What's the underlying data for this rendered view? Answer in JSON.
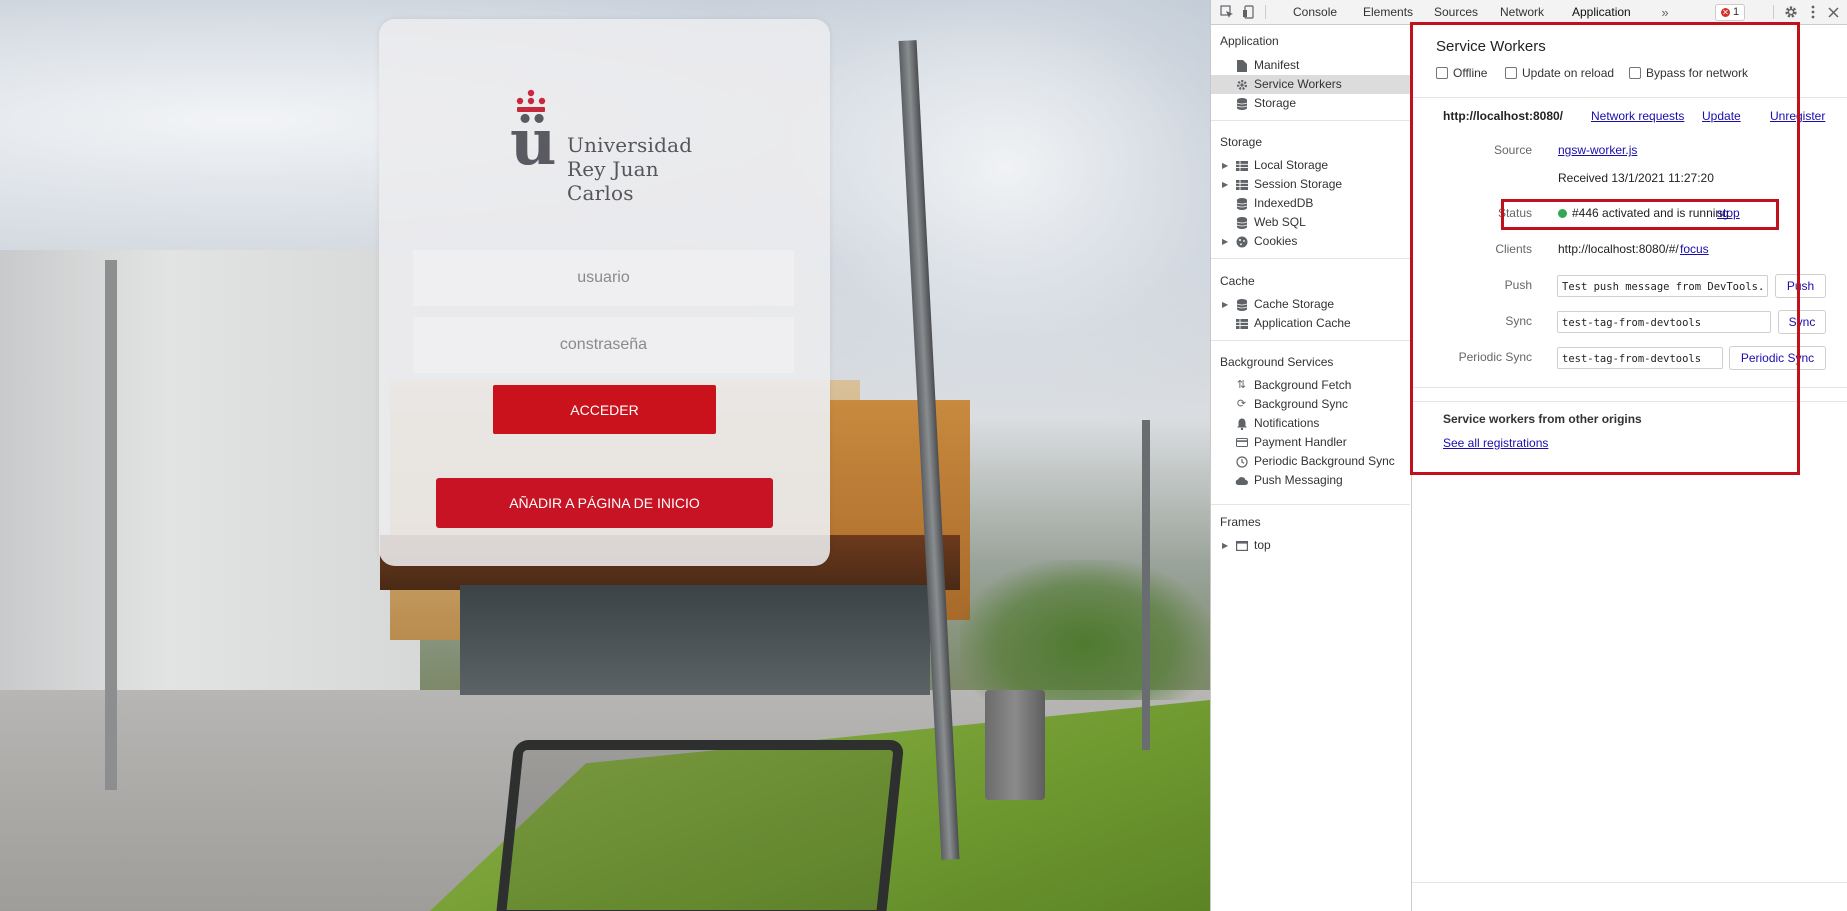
{
  "login": {
    "logo_line1": "Universidad",
    "logo_line2": "Rey Juan Carlos",
    "logo_mark": "ü",
    "username_placeholder": "usuario",
    "password_placeholder": "constraseña",
    "login_button": "ACCEDER",
    "install_button": "AÑADIR A PÁGINA DE INICIO",
    "brand_color": "#c9121b"
  },
  "devtools": {
    "tabs": [
      "Console",
      "Elements",
      "Sources",
      "Network",
      "Application"
    ],
    "active_tab": "Application",
    "error_count": "1",
    "icons": [
      "inspect-icon",
      "device-toolbar-icon",
      "more-tabs-icon",
      "settings-icon",
      "kebab-menu-icon",
      "close-icon"
    ],
    "sidebar": {
      "application_section": "Application",
      "application_items": [
        "Manifest",
        "Service Workers",
        "Storage"
      ],
      "storage_section": "Storage",
      "storage_items": [
        "Local Storage",
        "Session Storage",
        "IndexedDB",
        "Web SQL",
        "Cookies"
      ],
      "cache_section": "Cache",
      "cache_items": [
        "Cache Storage",
        "Application Cache"
      ],
      "background_section": "Background Services",
      "background_items": [
        "Background Fetch",
        "Background Sync",
        "Notifications",
        "Payment Handler",
        "Periodic Background Sync",
        "Push Messaging"
      ],
      "frames_section": "Frames",
      "frames_items": [
        "top"
      ],
      "selected_item": "Service Workers"
    },
    "service_workers": {
      "title": "Service Workers",
      "offline_label": "Offline",
      "update_on_reload_label": "Update on reload",
      "bypass_label": "Bypass for network",
      "origin": "http://localhost:8080/",
      "network_requests_link": "Network requests",
      "update_link": "Update",
      "unregister_link": "Unregister",
      "source_label": "Source",
      "source_link": "ngsw-worker.js",
      "received": "Received 13/1/2021 11:27:20",
      "status_label": "Status",
      "status_text": "#446 activated and is running",
      "stop_link": "stop",
      "status_color": "#34a853",
      "clients_label": "Clients",
      "clients_value": "http://localhost:8080/#/",
      "focus_link": "focus",
      "push_label": "Push",
      "push_value": "Test push message from DevTools.",
      "push_button": "Push",
      "sync_label": "Sync",
      "sync_value": "test-tag-from-devtools",
      "sync_button": "Sync",
      "periodic_label": "Periodic Sync",
      "periodic_value": "test-tag-from-devtools",
      "periodic_button": "Periodic Sync",
      "other_origins_title": "Service workers from other origins",
      "see_all_link": "See all registrations"
    },
    "highlight_color": "#c1121c"
  }
}
